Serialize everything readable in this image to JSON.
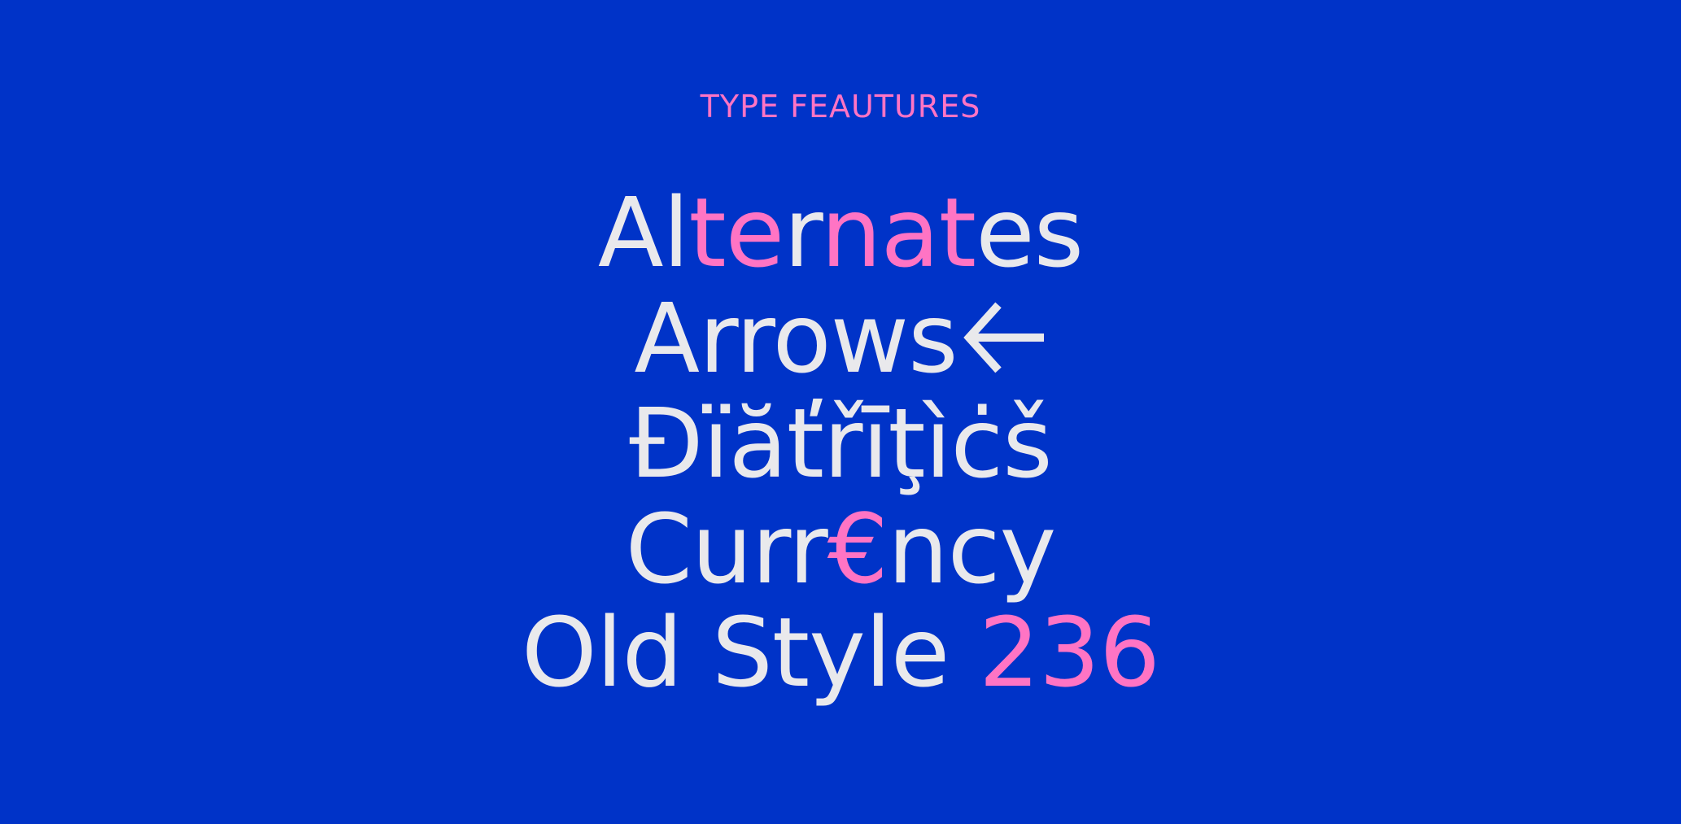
{
  "kicker": "TYPE FEAUTURES",
  "colors": {
    "background": "#0033c8",
    "text": "#e9e9ec",
    "accent": "#ff74c4"
  },
  "lines": {
    "alternates": {
      "seg1": "Al",
      "seg2": "te",
      "seg3": "r",
      "seg4": "n",
      "seg5": "at",
      "seg6": "es"
    },
    "arrows": {
      "text": "Arrows",
      "icon": "left-arrow-icon"
    },
    "diacritics": {
      "text": "Đïăťřīţìċš"
    },
    "currency": {
      "seg1": "Curr",
      "seg2": "€",
      "seg3": "ncy"
    },
    "old_style": {
      "text": "Old Style ",
      "numerals": "236"
    }
  }
}
